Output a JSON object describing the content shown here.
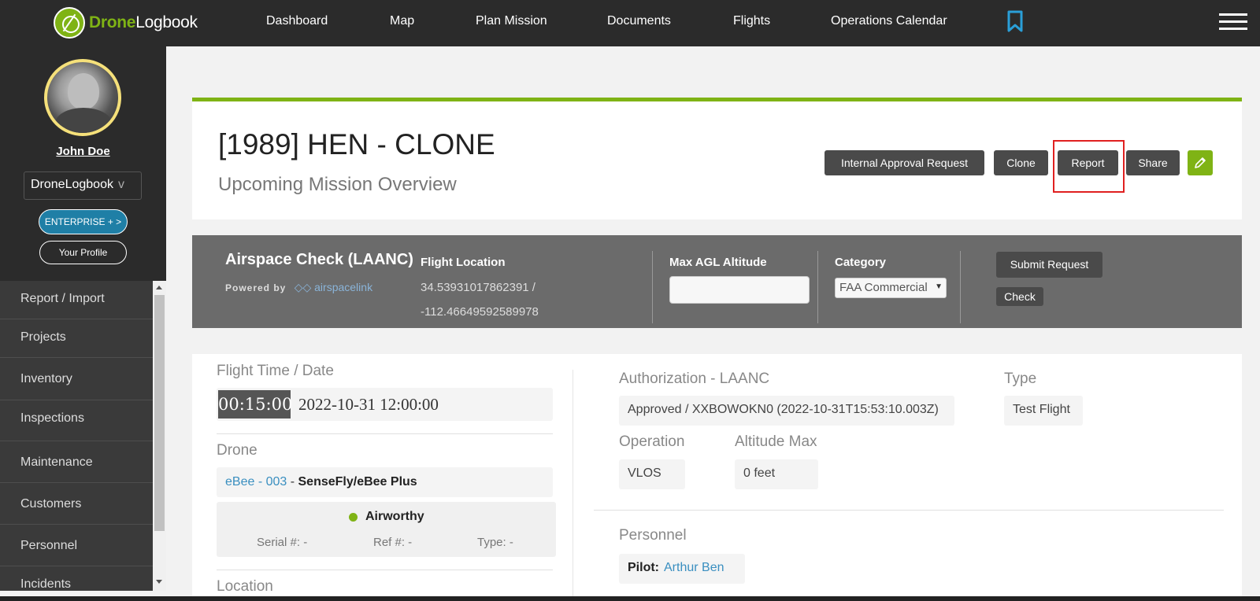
{
  "brand": {
    "part1": "Drone",
    "part2": "Logbook"
  },
  "nav": {
    "items": [
      "Dashboard",
      "Map",
      "Plan Mission",
      "Documents",
      "Flights",
      "Operations Calendar"
    ]
  },
  "sidebar": {
    "user_name": "John Doe",
    "account": "DroneLogbook",
    "account_chevron": "v",
    "enterprise_label": "ENTERPRISE + >",
    "profile_label": "Your Profile",
    "menu": [
      "Report / Import",
      "Projects",
      "Inventory",
      "Inspections",
      "Maintenance",
      "Customers",
      "Personnel",
      "Incidents"
    ]
  },
  "header": {
    "title": "[1989] HEN - CLONE",
    "subtitle": "Upcoming Mission Overview",
    "buttons": {
      "internal_approval": "Internal Approval Request",
      "clone": "Clone",
      "report": "Report",
      "share": "Share"
    }
  },
  "airspace": {
    "title": "Airspace Check (LAANC)",
    "powered_by": "Powered by",
    "provider": "airspacelink",
    "flight_location_label": "Flight Location",
    "lat": "34.53931017862391 /",
    "lon": "-112.46649592589978",
    "max_alt_label": "Max AGL Altitude",
    "max_alt_value": "",
    "category_label": "Category",
    "category_value": "FAA Commercial",
    "submit_label": "Submit Request",
    "check_label": "Check"
  },
  "details": {
    "flight_time_label": "Flight Time / Date",
    "duration": "00:15:00",
    "datetime": "2022-10-31 12:00:00",
    "drone_label": "Drone",
    "drone_link": "eBee - 003",
    "drone_sep": " - ",
    "drone_model": "SenseFly/eBee Plus",
    "status": "Airworthy",
    "serial": "Serial #: -",
    "ref": "Ref #: -",
    "type_meta": "Type: -",
    "location_label": "Location",
    "auth_label": "Authorization - LAANC",
    "auth_value": "Approved / XXBOWOKN0 (2022-10-31T15:53:10.003Z)",
    "type_label": "Type",
    "type_value": "Test Flight",
    "operation_label": "Operation",
    "operation_value": "VLOS",
    "altitude_label": "Altitude Max",
    "altitude_value": "0 feet",
    "personnel_label": "Personnel",
    "pilot_key": "Pilot:",
    "pilot_value": "Arthur Ben"
  },
  "colors": {
    "accent_green": "#7fb315",
    "nav_bg": "#2b2b2b",
    "link_blue": "#3a8fc0",
    "highlight_red": "#e02020"
  }
}
